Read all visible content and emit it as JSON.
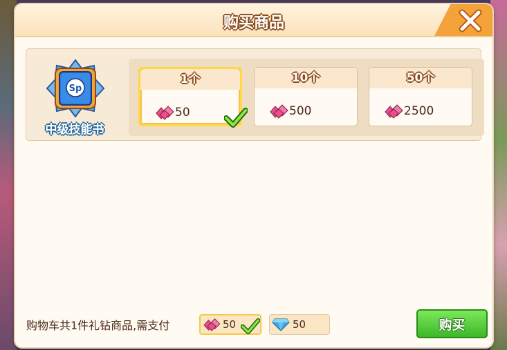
{
  "dialog": {
    "title": "购买商品"
  },
  "item": {
    "name": "中级技能书",
    "icon_label": "Sp",
    "icon": "skill-book-icon"
  },
  "options": [
    {
      "quantity": "1个",
      "price": "50",
      "selected": true
    },
    {
      "quantity": "10个",
      "price": "500",
      "selected": false
    },
    {
      "quantity": "50个",
      "price": "2500",
      "selected": false
    }
  ],
  "footer": {
    "summary": "购物车共1件礼钻商品,需支付",
    "gift_gem_cost": "50",
    "diamond_cost": "50",
    "gift_gem_selected": true,
    "buy_label": "购买"
  },
  "colors": {
    "gift_gem": "#e8508a",
    "diamond": "#3aa8e8",
    "buy_button": "#3cb82a",
    "close_tab": "#f4a23a"
  }
}
